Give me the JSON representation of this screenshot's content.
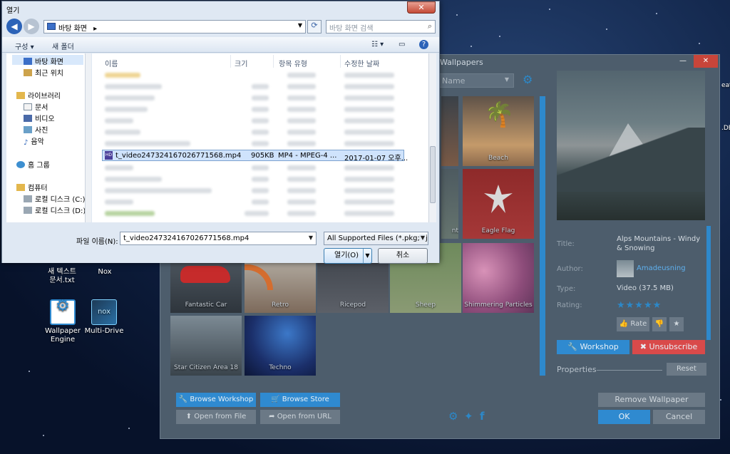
{
  "desktop": {
    "icons": [
      {
        "label": "새 텍스트\n문서.txt"
      },
      {
        "label": "Nox"
      },
      {
        "label": "Wallpaper\nEngine"
      },
      {
        "label": "Multi-Drive"
      }
    ],
    "edge_labels": [
      "eat",
      ".DE"
    ]
  },
  "wallpaper_engine": {
    "title": "Wallpapers",
    "sort_label": "Name",
    "tiles": [
      {
        "label": "Beach"
      },
      {
        "label": "nt"
      },
      {
        "label": "Eagle Flag"
      },
      {
        "label": "Fantastic Car"
      },
      {
        "label": "Retro"
      },
      {
        "label": "Ricepod"
      },
      {
        "label": "Sheep"
      },
      {
        "label": "Shimmering Particles"
      },
      {
        "label": "Star Citizen Area 18"
      },
      {
        "label": "Techno"
      }
    ],
    "details": {
      "title_label": "Title:",
      "title_value": "Alps Mountains - Windy & Snowing",
      "author_label": "Author:",
      "author_value": "Amadeusning",
      "type_label": "Type:",
      "type_value": "Video (37.5 MB)",
      "rating_label": "Rating:",
      "rating_stars": "★★★★★",
      "rate_button": "Rate"
    },
    "buttons": {
      "workshop": "Workshop",
      "unsubscribe": "Unsubscribe",
      "properties": "Properties",
      "reset": "Reset",
      "browse_workshop": "Browse Workshop",
      "browse_store": "Browse Store",
      "open_from_file": "Open from File",
      "open_from_url": "Open from URL",
      "remove_wallpaper": "Remove Wallpaper",
      "ok": "OK",
      "cancel": "Cancel"
    }
  },
  "dialog": {
    "title": "열기",
    "close_glyph": "✕",
    "address": "바탕 화면",
    "search_placeholder": "바탕 화면 검색",
    "toolbar": {
      "organize": "구성 ▾",
      "new_folder": "새 폴더"
    },
    "nav": {
      "desktop": "바탕 화면",
      "recent": "최근 위치",
      "libraries": "라이브러리",
      "documents": "문서",
      "videos": "비디오",
      "pictures": "사진",
      "music": "음악",
      "homegroup": "홈 그룹",
      "computer": "컴퓨터",
      "drive_c": "로컬 디스크 (C:)",
      "drive_d": "로컬 디스크 (D:)"
    },
    "columns": {
      "name": "이름",
      "size": "크기",
      "type": "항목 유형",
      "modified": "수정한 날짜"
    },
    "selected_file": {
      "name": "t_video247324167026771568.mp4",
      "size": "905KB",
      "type": "MP4 - MPEG-4 ...",
      "modified": "2017-01-07 오후..."
    },
    "filename_label": "파일 이름(N):",
    "filename_value": "t_video247324167026771568.mp4",
    "filter_value": "All Supported Files (*.pkg;*.jso",
    "open_button": "열기(O)",
    "cancel_button": "취소"
  },
  "colors": {
    "accent_blue": "#2f8ad0",
    "unsubscribe_red": "#d94a4a",
    "we_background": "#4d5d6c"
  }
}
